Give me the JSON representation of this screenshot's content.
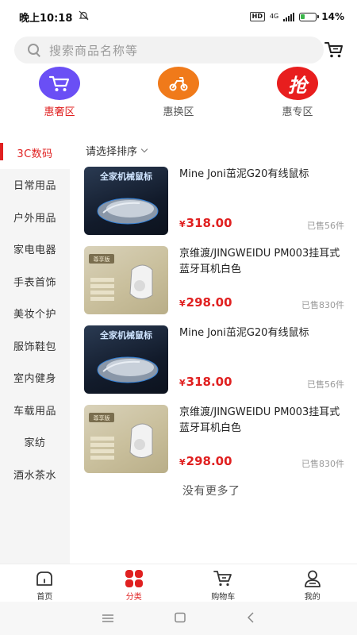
{
  "status_bar": {
    "time": "晚上10:18",
    "hd": "HD",
    "network": "4G",
    "battery_percent": "14%",
    "mute_icon": "bell-off-icon"
  },
  "search": {
    "placeholder": "搜索商品名称等",
    "icon": "search-icon",
    "cart_icon": "shopping-cart-icon"
  },
  "zones": [
    {
      "label": "惠奢区",
      "icon": "cart-icon",
      "color": "#6a4ff5",
      "active": true
    },
    {
      "label": "惠换区",
      "icon": "scooter-icon",
      "color": "#f07a1a",
      "active": false
    },
    {
      "label": "惠专区",
      "icon": "grab-icon",
      "icon_text": "抢",
      "color": "#e81e1e",
      "active": false
    }
  ],
  "sidebar": {
    "items": [
      {
        "label": "3C数码",
        "active": true
      },
      {
        "label": "日常用品"
      },
      {
        "label": "户外用品"
      },
      {
        "label": "家电电器"
      },
      {
        "label": "手表首饰"
      },
      {
        "label": "美妆个护"
      },
      {
        "label": "服饰鞋包"
      },
      {
        "label": "室内健身"
      },
      {
        "label": "车载用品"
      },
      {
        "label": "家纺"
      },
      {
        "label": "酒水茶水"
      }
    ]
  },
  "sort": {
    "label": "请选择排序"
  },
  "products": [
    {
      "title": "Mine Joni茁泥G20有线鼠标",
      "currency": "¥",
      "price": "318.00",
      "sold": "已售56件",
      "image": "mouse-image",
      "img_text": "全家机械鼠标"
    },
    {
      "title": "京维渡/JINGWEIDU PM003挂耳式蓝牙耳机白色",
      "currency": "¥",
      "price": "298.00",
      "sold": "已售830件",
      "image": "earphone-image",
      "img_text": "尊享版"
    },
    {
      "title": "Mine Joni茁泥G20有线鼠标",
      "currency": "¥",
      "price": "318.00",
      "sold": "已售56件",
      "image": "mouse-image",
      "img_text": "全家机械鼠标"
    },
    {
      "title": "京维渡/JINGWEIDU PM003挂耳式蓝牙耳机白色",
      "currency": "¥",
      "price": "298.00",
      "sold": "已售830件",
      "image": "earphone-image",
      "img_text": "尊享版"
    }
  ],
  "no_more": "没有更多了",
  "bottom_nav": {
    "items": [
      {
        "label": "首页",
        "icon": "home-icon",
        "active": false
      },
      {
        "label": "分类",
        "icon": "category-icon",
        "active": true
      },
      {
        "label": "购物车",
        "icon": "cart-icon",
        "active": false
      },
      {
        "label": "我的",
        "icon": "user-icon",
        "active": false
      }
    ]
  },
  "system_nav": [
    "menu-icon",
    "home-square-icon",
    "back-icon"
  ],
  "colors": {
    "accent": "#e02020",
    "sidebar_bg": "#f5f5f5"
  }
}
